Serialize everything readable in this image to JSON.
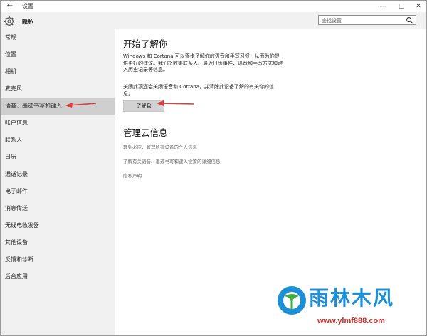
{
  "titlebar": {
    "back_glyph": "←",
    "title": "设置",
    "minimize_glyph": "—",
    "maximize_glyph": "□",
    "close_glyph": "✕"
  },
  "sidebar": {
    "header": "隐私",
    "header_icon": "gear-icon",
    "items": [
      {
        "label": "常规",
        "active": false
      },
      {
        "label": "位置",
        "active": false
      },
      {
        "label": "相机",
        "active": false
      },
      {
        "label": "麦克风",
        "active": false
      },
      {
        "label": "语音、墨迹书写和键入",
        "active": true
      },
      {
        "label": "帐户信息",
        "active": false
      },
      {
        "label": "联系人",
        "active": false
      },
      {
        "label": "日历",
        "active": false
      },
      {
        "label": "通话记录",
        "active": false
      },
      {
        "label": "电子邮件",
        "active": false
      },
      {
        "label": "消息传送",
        "active": false
      },
      {
        "label": "无线电收发器",
        "active": false
      },
      {
        "label": "其他设备",
        "active": false
      },
      {
        "label": "反馈和诊断",
        "active": false
      },
      {
        "label": "后台应用",
        "active": false
      }
    ]
  },
  "search": {
    "placeholder": "查找设置",
    "icon": "search-icon"
  },
  "main": {
    "section1": {
      "title": "开始了解你",
      "desc1": "Windows 和 Cortana 可以逐步了解你的语音和手写习惯，从而为你提供更好的建议。我们将收集联系人、最近日历事件、语音和手写方式和键入历史记录等信息。",
      "desc2": "关闭此项还会关闭语音和 Cortana，并清除此设备了解的有关你的信息。",
      "button": "了解我"
    },
    "section2": {
      "title": "管理云信息",
      "links": [
        "转到必应，管理所有设备的个人信息",
        "了解有关语音、墨迹书写和键入设置的详细信息",
        "隐私声明"
      ]
    }
  },
  "watermark": {
    "brand": "雨林木风",
    "url": "www.ylmf888.com"
  },
  "colors": {
    "annotation_arrow": "#e03a3a",
    "watermark_blue": "#1d8fd6",
    "watermark_red": "#c0312d",
    "sidebar_bg": "#f1f1f1",
    "active_item_bg": "#cfcfcf"
  }
}
